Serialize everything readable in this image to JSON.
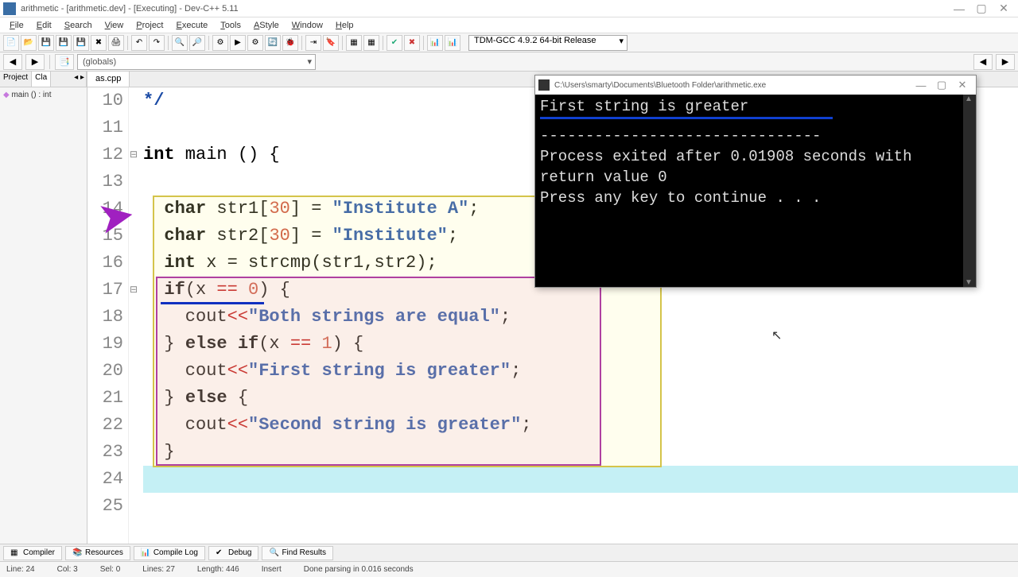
{
  "title": "arithmetic - [arithmetic.dev] - [Executing] - Dev-C++ 5.11",
  "menus": [
    "File",
    "Edit",
    "Search",
    "View",
    "Project",
    "Execute",
    "Tools",
    "AStyle",
    "Window",
    "Help"
  ],
  "compiler": "TDM-GCC 4.9.2 64-bit Release",
  "globals": "(globals)",
  "leftTabs": {
    "project": "Project",
    "classes": "Cla",
    "arrows": "◂ ▸"
  },
  "leftItem": "main () : int",
  "editorTab": "as.cpp",
  "lines": {
    "10": "*/",
    "11": "",
    "12": "int main () {",
    "13": "",
    "14": "  char str1[30] = \"Institute A\";",
    "15": "  char str2[30] = \"Institute\";",
    "16": "  int x = strcmp(str1,str2);",
    "17": "  if(x == 0) {",
    "18": "    cout<<\"Both strings are equal\";",
    "19": "  } else if(x == 1) {",
    "20": "    cout<<\"First string is greater\";",
    "21": "  } else {",
    "22": "    cout<<\"Second string is greater\";",
    "23": "  }",
    "24": "",
    "25": ""
  },
  "lineNums": [
    "10",
    "11",
    "12",
    "13",
    "14",
    "15",
    "16",
    "17",
    "18",
    "19",
    "20",
    "21",
    "22",
    "23",
    "24",
    "25"
  ],
  "console": {
    "title": "C:\\Users\\smarty\\Documents\\Bluetooth Folder\\arithmetic.exe",
    "out1": "First string is greater",
    "dash": "-------------------------------",
    "out2": "Process exited after 0.01908 seconds with return value 0",
    "out3": "Press any key to continue . . ."
  },
  "bottomTabs": {
    "compiler": "Compiler",
    "resources": "Resources",
    "compilelog": "Compile Log",
    "debug": "Debug",
    "findresults": "Find Results"
  },
  "status": {
    "line": "Line:  24",
    "col": "Col:  3",
    "sel": "Sel:  0",
    "lines": "Lines:  27",
    "length": "Length:  446",
    "insert": "Insert",
    "done": "Done parsing in 0.016 seconds"
  }
}
